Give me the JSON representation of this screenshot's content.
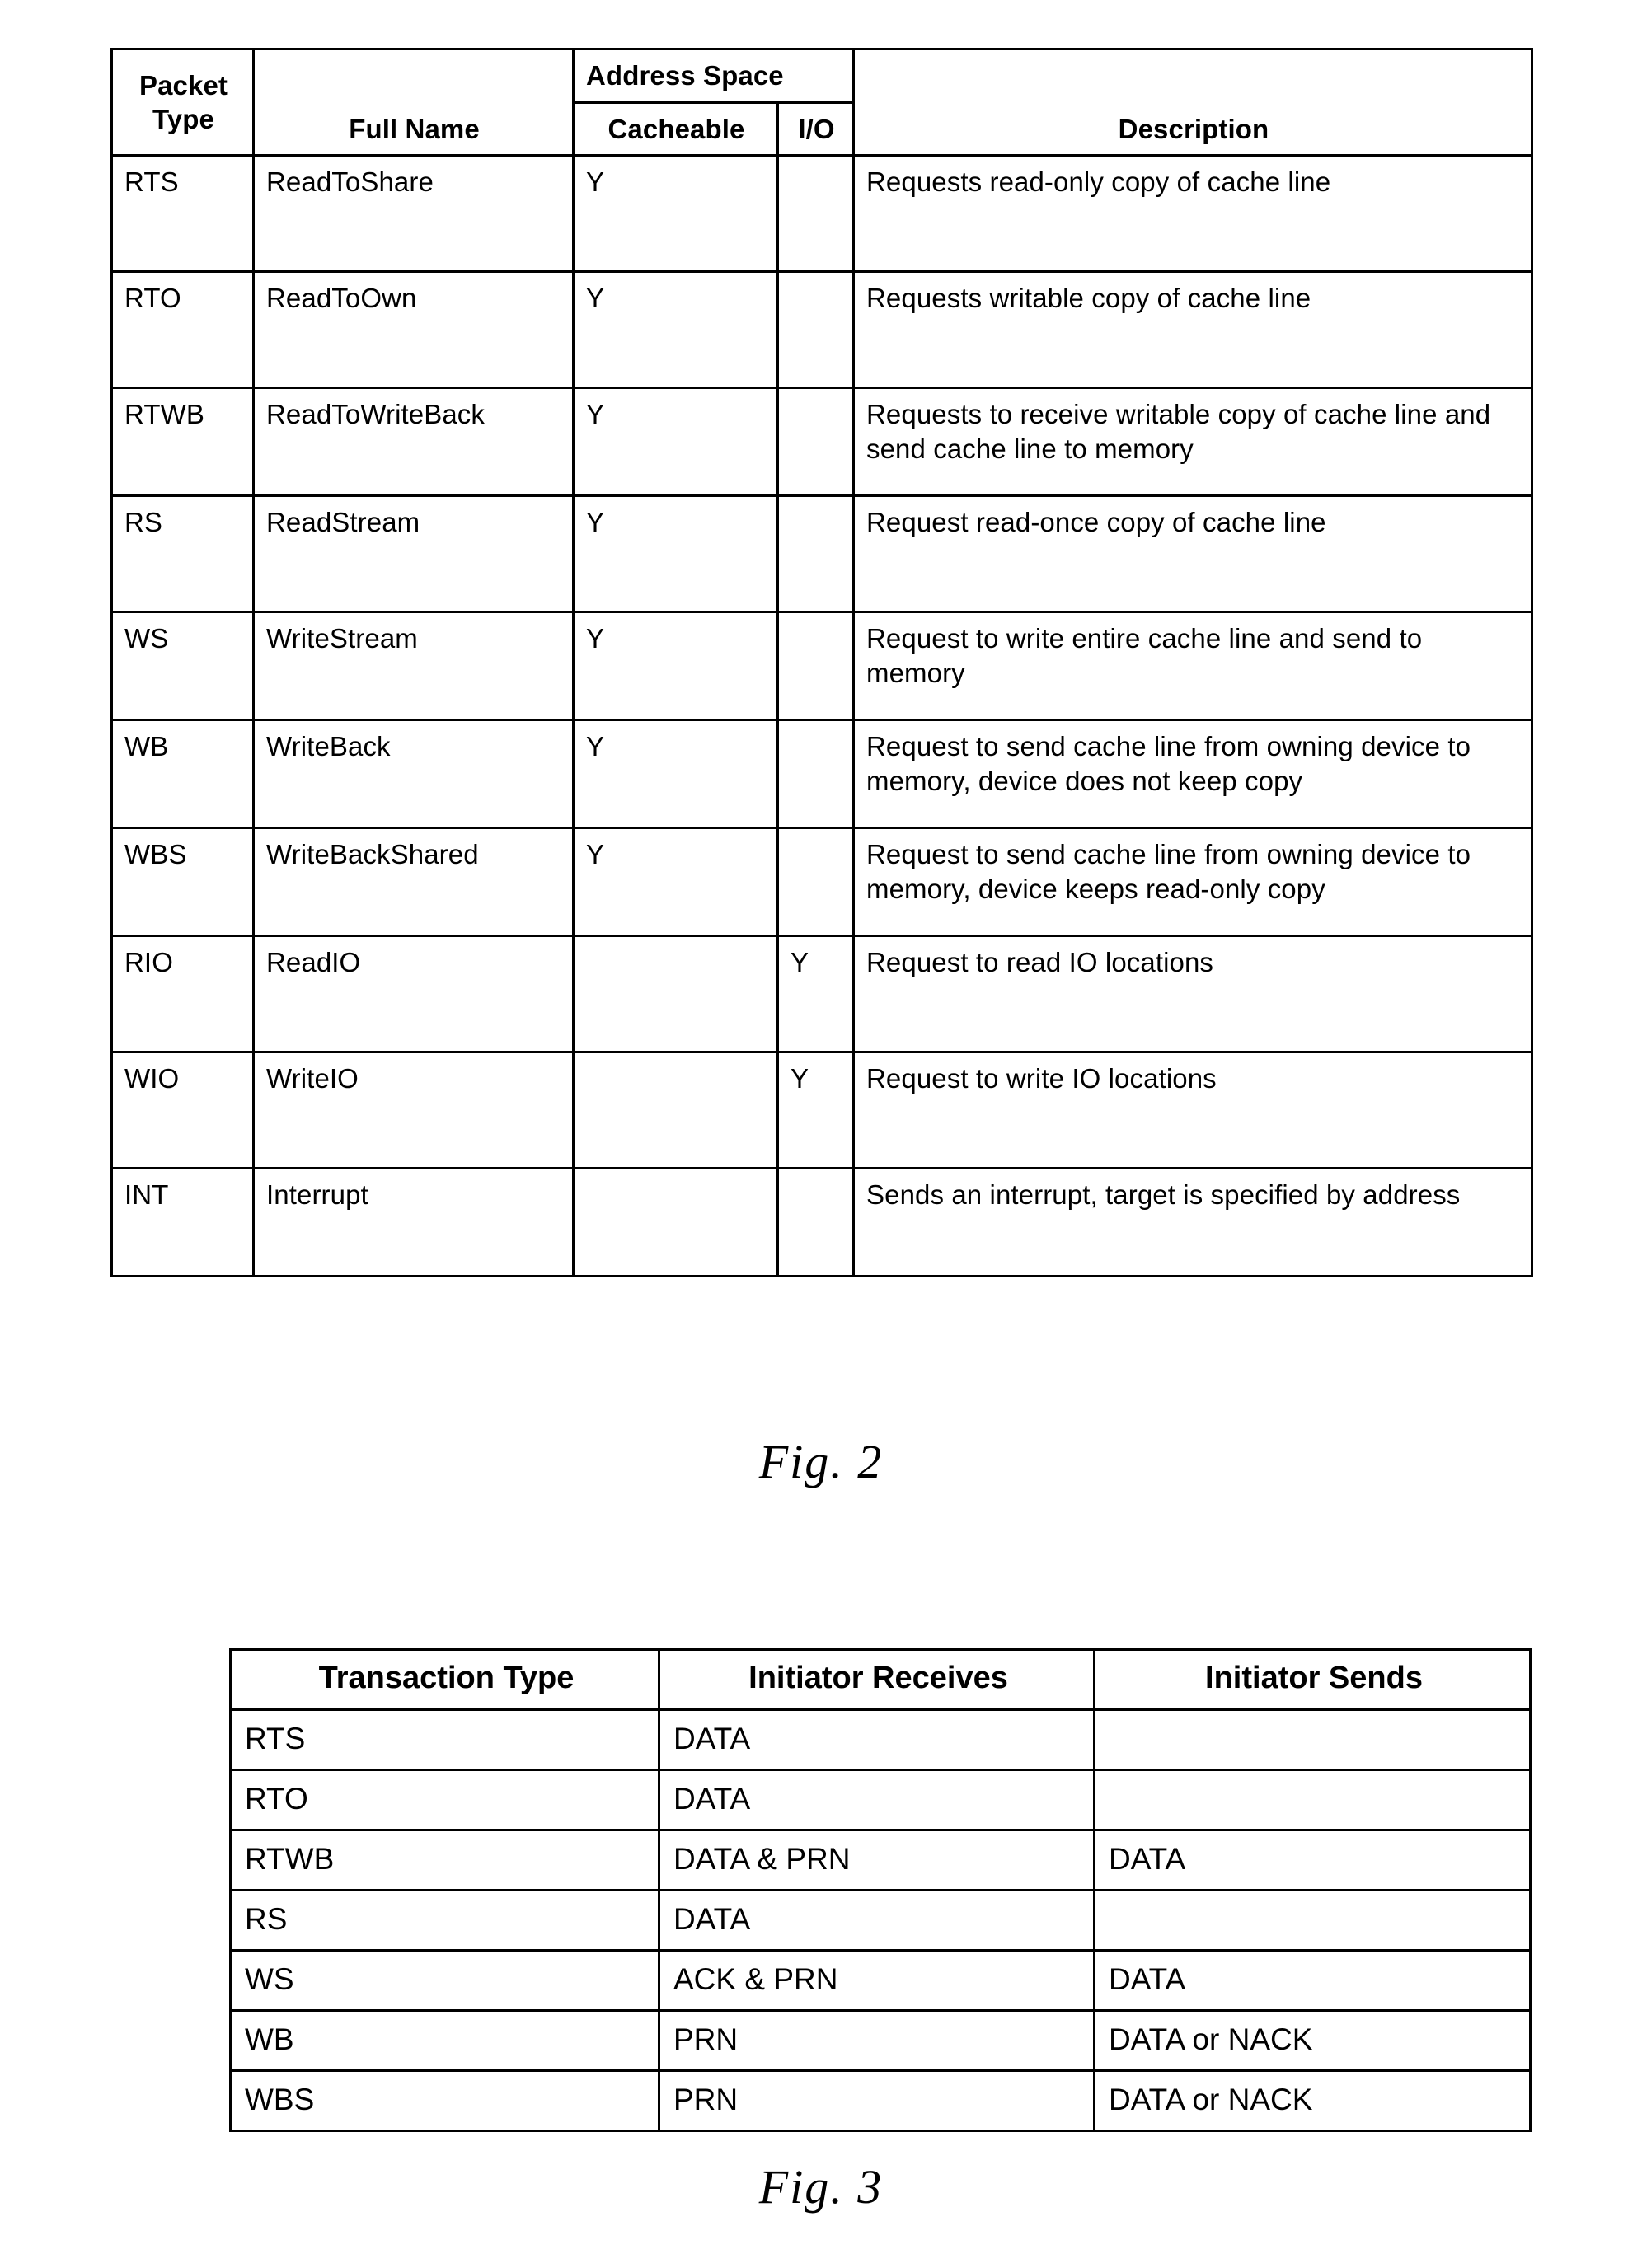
{
  "figure2": {
    "caption": "Fig. 2",
    "headers": {
      "packet_type": "Packet Type",
      "packet_type_line1": "Packet",
      "packet_type_line2": "Type",
      "full_name": "Full Name",
      "address_space": "Address Space",
      "cacheable": "Cacheable",
      "io": "I/O",
      "description": "Description"
    },
    "rows": [
      {
        "packet_type": "RTS",
        "full_name": "ReadToShare",
        "cacheable": "Y",
        "io": "",
        "description": "Requests read-only copy of cache line"
      },
      {
        "packet_type": "RTO",
        "full_name": "ReadToOwn",
        "cacheable": "Y",
        "io": "",
        "description": "Requests writable copy of cache line"
      },
      {
        "packet_type": "RTWB",
        "full_name": "ReadToWriteBack",
        "cacheable": "Y",
        "io": "",
        "description": "Requests to receive writable copy of cache line and send cache line to memory"
      },
      {
        "packet_type": "RS",
        "full_name": "ReadStream",
        "cacheable": "Y",
        "io": "",
        "description": "Request read-once copy of cache line"
      },
      {
        "packet_type": "WS",
        "full_name": "WriteStream",
        "cacheable": "Y",
        "io": "",
        "description": "Request to write entire cache line and send to memory"
      },
      {
        "packet_type": "WB",
        "full_name": "WriteBack",
        "cacheable": "Y",
        "io": "",
        "description": "Request to send cache line from owning device to memory, device does not keep copy"
      },
      {
        "packet_type": "WBS",
        "full_name": "WriteBackShared",
        "cacheable": "Y",
        "io": "",
        "description": "Request to send cache line from owning device to memory, device keeps read-only copy"
      },
      {
        "packet_type": "RIO",
        "full_name": "ReadIO",
        "cacheable": "",
        "io": "Y",
        "description": "Request to read IO locations"
      },
      {
        "packet_type": "WIO",
        "full_name": "WriteIO",
        "cacheable": "",
        "io": "Y",
        "description": "Request to write IO locations"
      },
      {
        "packet_type": "INT",
        "full_name": "Interrupt",
        "cacheable": "",
        "io": "",
        "description": "Sends an interrupt, target is specified by address"
      }
    ]
  },
  "figure3": {
    "caption": "Fig. 3",
    "headers": {
      "transaction_type": "Transaction Type",
      "initiator_receives": "Initiator Receives",
      "initiator_sends": "Initiator Sends"
    },
    "rows": [
      {
        "transaction_type": "RTS",
        "initiator_receives": "DATA",
        "initiator_sends": ""
      },
      {
        "transaction_type": "RTO",
        "initiator_receives": "DATA",
        "initiator_sends": ""
      },
      {
        "transaction_type": "RTWB",
        "initiator_receives": "DATA & PRN",
        "initiator_sends": "DATA"
      },
      {
        "transaction_type": "RS",
        "initiator_receives": "DATA",
        "initiator_sends": ""
      },
      {
        "transaction_type": "WS",
        "initiator_receives": "ACK & PRN",
        "initiator_sends": "DATA"
      },
      {
        "transaction_type": "WB",
        "initiator_receives": "PRN",
        "initiator_sends": "DATA or NACK"
      },
      {
        "transaction_type": "WBS",
        "initiator_receives": "PRN",
        "initiator_sends": "DATA or NACK"
      }
    ]
  }
}
